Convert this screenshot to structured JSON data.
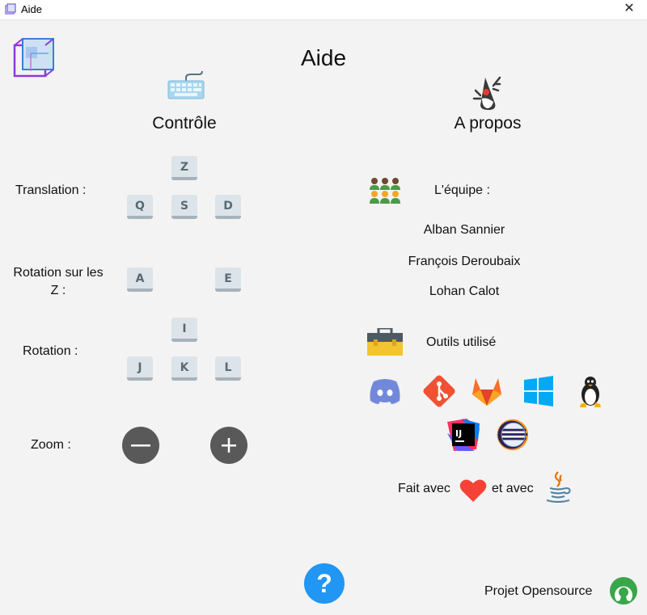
{
  "window": {
    "title": "Aide",
    "close_symbol": "✕"
  },
  "page": {
    "title": "Aide"
  },
  "controls": {
    "title": "Contrôle",
    "translation_label": "Translation :",
    "rotation_z_label": "Rotation sur les Z :",
    "rotation_label": "Rotation :",
    "zoom_label": "Zoom :",
    "keys": {
      "z": "Z",
      "q": "Q",
      "s": "S",
      "d": "D",
      "a": "A",
      "e": "E",
      "i": "I",
      "j": "J",
      "k": "K",
      "l": "L"
    }
  },
  "about": {
    "title": "A propos",
    "team_label": "L'équipe :",
    "team": [
      "Alban Sannier",
      "François Deroubaix",
      "Lohan Calot"
    ],
    "tools_label": "Outils utilisé",
    "tools": [
      "discord-icon",
      "git-icon",
      "gitlab-icon",
      "windows-icon",
      "linux-icon",
      "intellij-icon",
      "eclipse-icon"
    ],
    "made_with": "Fait avec",
    "and_with": "et avec"
  },
  "footer": {
    "help_symbol": "?",
    "opensource_label": "Projet Opensource"
  },
  "colors": {
    "background": "#f3f3f3",
    "key_face": "#dce4ea",
    "zoom_button": "#595959",
    "help_button": "#2196f3",
    "opensource": "#3aa64a"
  }
}
